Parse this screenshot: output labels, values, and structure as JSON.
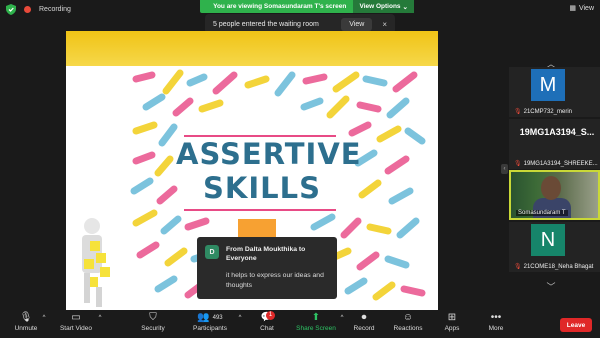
{
  "top": {
    "recording": "Recording",
    "viewing_banner": "You are viewing Somasundaram T's screen",
    "view_options": "View Options",
    "view_button": "View"
  },
  "waiting_room": {
    "message": "5 people entered the waiting room",
    "view_label": "View",
    "close": "×"
  },
  "slide": {
    "line1": "ASSERTIVE",
    "line2": "SKILLS"
  },
  "chat_popup": {
    "avatar_letter": "D",
    "from": "From Dalta Moukthika to Everyone",
    "message": "it helps to express our ideas and thoughts"
  },
  "participants_panel": {
    "tiles": [
      {
        "letter": "M",
        "name": "21CMP732_merin",
        "avatar_color": "#1e6fb8"
      },
      {
        "big_name": "19MG1A3194_S...",
        "name": "19MG1A3194_SHREEKE..."
      },
      {
        "name": "Somasundaram T"
      },
      {
        "letter": "N",
        "name": "21COME18_Neha Bhagat",
        "avatar_color": "#16856a"
      }
    ]
  },
  "toolbar": {
    "unmute": "Unmute",
    "start_video": "Start Video",
    "security": "Security",
    "participants": "Participants",
    "participants_count": "493",
    "chat": "Chat",
    "chat_badge": "1",
    "share_screen": "Share Screen",
    "record": "Record",
    "reactions": "Reactions",
    "apps": "Apps",
    "more": "More",
    "leave": "Leave"
  },
  "colors": {
    "share_green": "#2ec264",
    "banner_green": "#2fb24c",
    "leave_red": "#e02828",
    "title_blue": "#2d6f8e",
    "active_border": "#c9d837"
  }
}
